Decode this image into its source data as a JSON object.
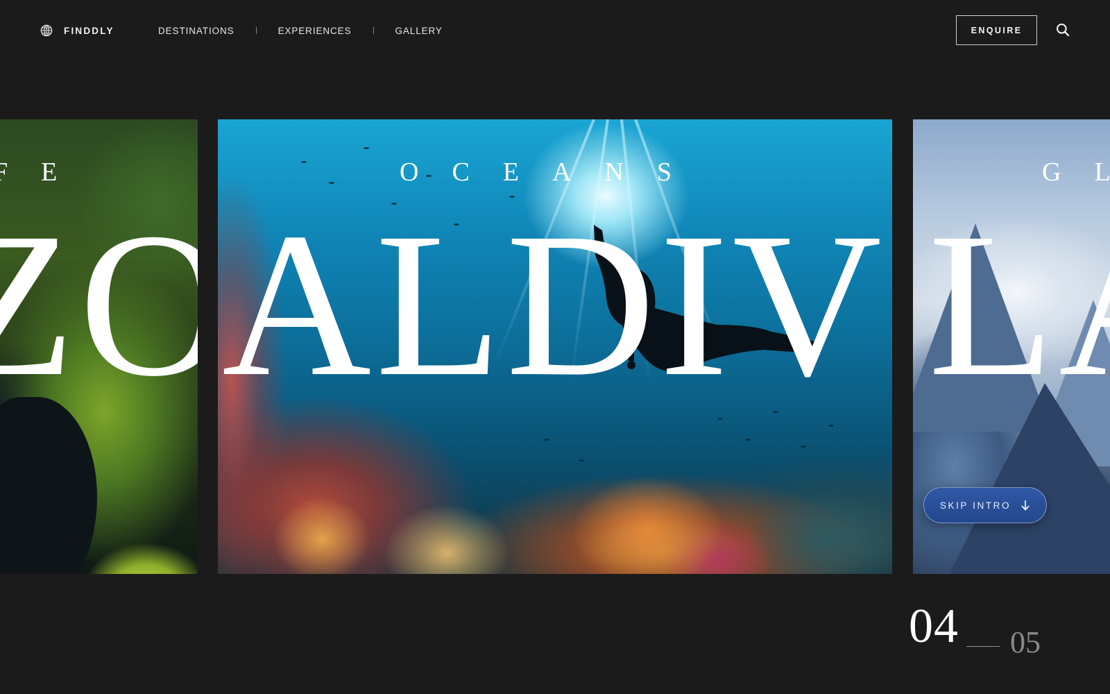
{
  "brand": {
    "name": "FINDDLY",
    "icon": "globe-icon"
  },
  "nav": {
    "items": [
      {
        "label": "DESTINATIONS"
      },
      {
        "label": "EXPERIENCES"
      },
      {
        "label": "GALLERY"
      }
    ]
  },
  "header": {
    "enquire_label": "ENQUIRE",
    "search_icon": "search-icon"
  },
  "slides": {
    "previous": {
      "kicker": "FE",
      "word": "ZO"
    },
    "current": {
      "kicker": "OCEANS",
      "word": "ALDIV"
    },
    "next": {
      "kicker": "GL",
      "word": "LA"
    }
  },
  "skip": {
    "label": "SKIP INTRO",
    "icon": "arrow-down-icon"
  },
  "counter": {
    "current": "04",
    "total": "05"
  }
}
